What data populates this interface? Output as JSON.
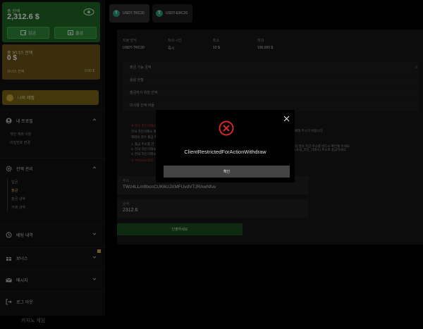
{
  "sidebar": {
    "balance": {
      "label": "총 잔액",
      "amount": "2,312.6 $",
      "deposit_label": "입금",
      "withdraw_label": "출금"
    },
    "bonus": {
      "label": "총 보너스 잔액",
      "amount": "0 $",
      "sub_label": "보너스 잔액",
      "sub_value": "0.00 $"
    },
    "level_label": "나의 레벨",
    "profile": {
      "label": "내 프로필",
      "items": [
        "개인 계좌 사항",
        "비밀번호 변경"
      ]
    },
    "wallet": {
      "label": "잔액 관리",
      "items": [
        "입금",
        "출금",
        "출금 내역",
        "거래 내역"
      ],
      "active_index": 1
    },
    "betting_history_label": "베팅 내역",
    "bonus_menu_label": "보너스",
    "messages_label": "메시지",
    "logout_label": "로그 아웃"
  },
  "footer": {
    "casino_label": "카지노 게임"
  },
  "main": {
    "tabs": [
      {
        "label": "USDT-TRC20",
        "icon": "T"
      },
      {
        "label": "USDT-ERC20",
        "icon": "T"
      }
    ],
    "info": {
      "headers": [
        "지불 방식",
        "처리 시간",
        "최소",
        "최대"
      ],
      "values": [
        "USDT-TRC20",
        "즉시",
        "10 $",
        "100,000 $"
      ]
    },
    "rows": [
      "출금 가능 금액",
      "롤링 현황",
      "출금하기 위한 잔액",
      "미사용 잔액 비율"
    ],
    "row_value_mark": "0",
    "notice_lines": [
      "※ 한국 코인거래소",
      "한국 코인거래소 회",
      "해외의 경우 출금 지"
    ],
    "notice_right_1": "예해 주시기 바랍니다.",
    "numbered_lines": [
      "1. 출금 주소를 한",
      "2. 한국 코인거래소",
      "3. 한국 코인거래소"
    ],
    "numbered_right": "의 경우 지갑 주소를 반드시 확인해 주세요.",
    "numbered_right_2": "(국내_코인_거래소) 주소로 송금하세요.",
    "notice_tail": "※ TRC20으로만",
    "address": {
      "label": "주소",
      "value": "TWz4LLm9bcnCUK6UJXMFUvdV7JRAwNfuv"
    },
    "amount": {
      "label": "금액",
      "value": "2312.6"
    },
    "submit_label": "인출하세요"
  },
  "modal": {
    "message": "ClientRestrictedForActionWithdraw",
    "confirm_label": "확인"
  },
  "colors": {
    "balance_green": "#1f6b25",
    "bonus_gold": "#6b5417",
    "error_red": "#d62828",
    "submit_green": "#1a4d1f"
  }
}
